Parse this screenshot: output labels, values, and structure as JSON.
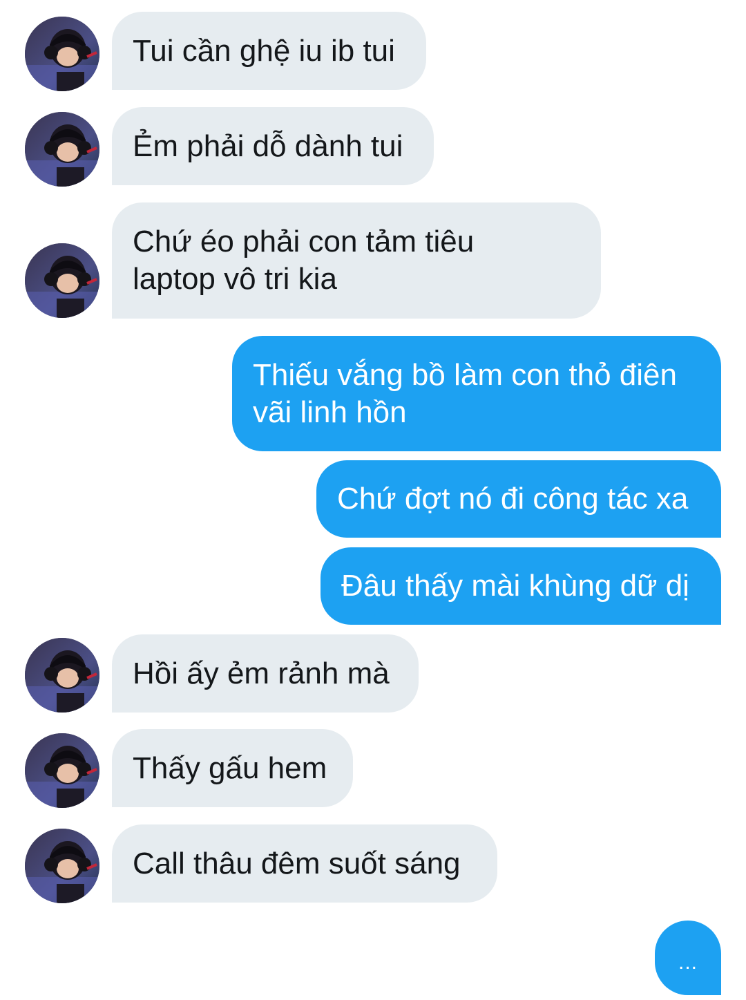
{
  "messages": [
    {
      "id": "m1",
      "side": "in",
      "text": "Tui cần ghệ iu ib tui"
    },
    {
      "id": "m2",
      "side": "in",
      "text": "Ẻm phải dỗ dành tui"
    },
    {
      "id": "m3",
      "side": "in",
      "lines": [
        "Chứ éo phải con tảm tiêu",
        "laptop vô tri kia"
      ]
    },
    {
      "id": "m4",
      "side": "out",
      "lines": [
        "Thiếu vắng bồ làm con thỏ điên",
        "vãi linh hồn"
      ]
    },
    {
      "id": "m5",
      "side": "out",
      "text": "Chứ đợt nó đi công tác xa"
    },
    {
      "id": "m6",
      "side": "out",
      "text": "Đâu thấy mài khùng dữ dị"
    },
    {
      "id": "m7",
      "side": "in",
      "text": "Hồi ấy ẻm rảnh mà"
    },
    {
      "id": "m8",
      "side": "in",
      "text": "Thấy gấu hem"
    },
    {
      "id": "m9",
      "side": "in",
      "text": "Call thâu đêm suốt sáng"
    }
  ],
  "typing_indicator": {
    "text": "..."
  },
  "colors": {
    "incoming_bubble": "#e6ecf0",
    "incoming_text": "#14171a",
    "outgoing_bubble": "#1da1f2",
    "outgoing_text": "#ffffff",
    "background": "#ffffff"
  },
  "icons": {
    "avatar": "profile-photo-person-with-headphones"
  }
}
